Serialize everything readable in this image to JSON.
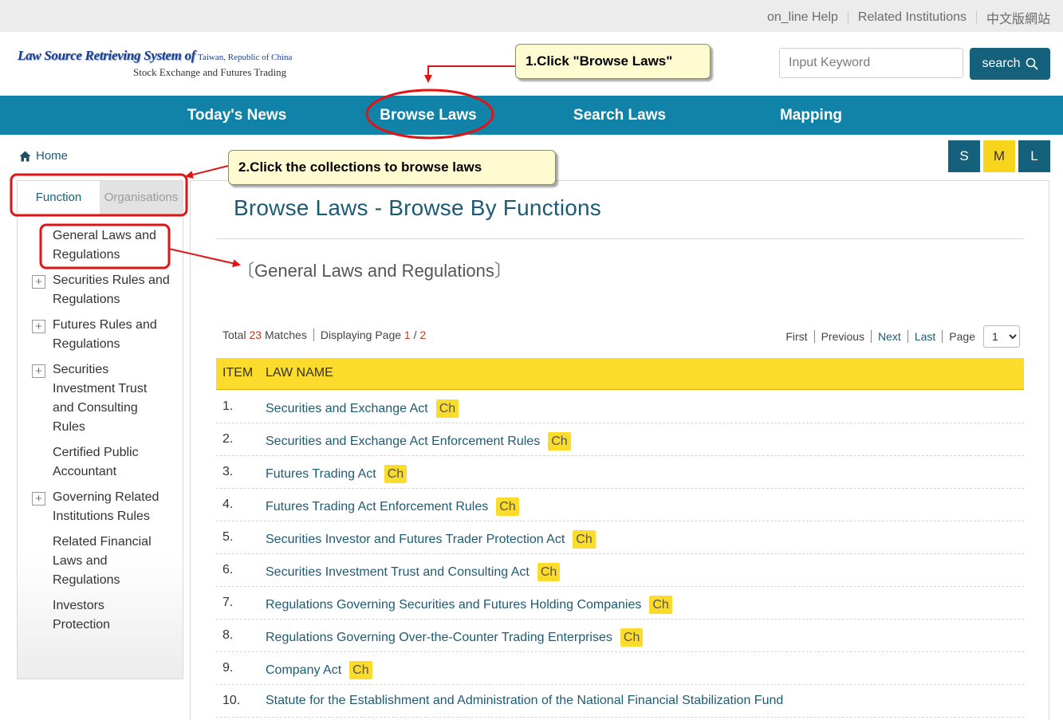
{
  "top_links": [
    "on_line Help",
    "Related Institutions",
    "中文版網站"
  ],
  "logo": {
    "line1": "Law Source Retrieving System of",
    "line1_small": "Taiwan, Republic of China",
    "line2": "Stock Exchange and Futures Trading"
  },
  "search": {
    "placeholder": "Input Keyword",
    "button_label": "search"
  },
  "nav": [
    "Today's News",
    "Browse Laws",
    "Search Laws",
    "Mapping"
  ],
  "breadcrumb": {
    "home": "Home"
  },
  "font_sizes": {
    "small": "S",
    "medium": "M",
    "large": "L",
    "selected": "M"
  },
  "sidebar": {
    "tabs": [
      "Function",
      "Organisations"
    ],
    "items": [
      {
        "label": "General Laws and Regulations",
        "expandable": false
      },
      {
        "label": "Securities Rules and Regulations",
        "expandable": true
      },
      {
        "label": "Futures Rules and Regulations",
        "expandable": true
      },
      {
        "label": "Securities Investment Trust and Consulting Rules",
        "expandable": true
      },
      {
        "label": "Certified Public Accountant",
        "expandable": false
      },
      {
        "label": "Governing Related Institutions Rules",
        "expandable": true
      },
      {
        "label": "Related Financial Laws and Regulations",
        "expandable": false
      },
      {
        "label": "Investors Protection",
        "expandable": false
      }
    ]
  },
  "main": {
    "title": "Browse Laws - Browse By Functions",
    "category": "General Laws and Regulations",
    "total_label": "Total",
    "total": "23",
    "matches_label": "Matches",
    "displaying_label": "Displaying Page",
    "page_current": "1",
    "page_total": "2",
    "pager": {
      "first": "First",
      "previous": "Previous",
      "next": "Next",
      "last": "Last",
      "page_label": "Page",
      "page_select": "1"
    },
    "columns": [
      "ITEM",
      "LAW NAME"
    ],
    "ch_label": "Ch",
    "rows": [
      {
        "num": "1.",
        "name": "Securities and Exchange Act",
        "ch": true
      },
      {
        "num": "2.",
        "name": "Securities and Exchange Act Enforcement Rules",
        "ch": true
      },
      {
        "num": "3.",
        "name": "Futures Trading Act",
        "ch": true
      },
      {
        "num": "4.",
        "name": "Futures Trading Act Enforcement Rules",
        "ch": true
      },
      {
        "num": "5.",
        "name": "Securities Investor and Futures Trader Protection Act",
        "ch": true
      },
      {
        "num": "6.",
        "name": "Securities Investment Trust and Consulting Act",
        "ch": true
      },
      {
        "num": "7.",
        "name": "Regulations Governing Securities and Futures Holding Companies",
        "ch": true
      },
      {
        "num": "8.",
        "name": "Regulations Governing Over-the-Counter Trading Enterprises",
        "ch": true
      },
      {
        "num": "9.",
        "name": "Company Act",
        "ch": true
      },
      {
        "num": "10.",
        "name": "Statute for the Establishment and Administration of the National Financial Stabilization Fund",
        "ch": false
      }
    ]
  },
  "annotations": {
    "callout1": "1.Click \"Browse Laws\"",
    "callout2": "2.Click the collections to browse laws"
  },
  "colors": {
    "nav_bg": "#1283a8",
    "button_bg": "#15607a",
    "accent_yellow": "#fbdb2b",
    "annotation_red": "#e01414",
    "count_red": "#c0392b"
  }
}
